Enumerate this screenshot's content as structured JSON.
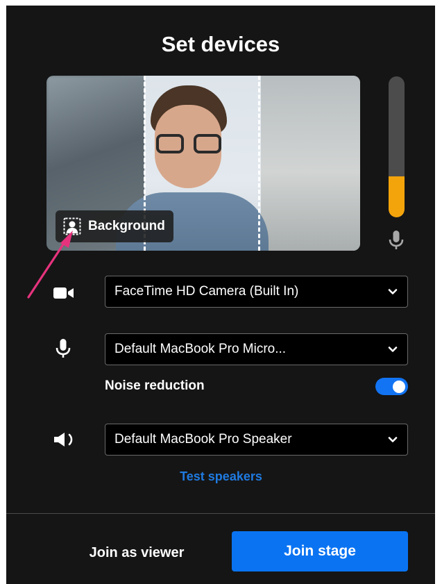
{
  "title": "Set devices",
  "preview": {
    "background_button_label": "Background",
    "background_icon": "background-person-icon"
  },
  "mic_level": 0.29,
  "camera": {
    "icon": "video-camera-icon",
    "selected": "FaceTime HD Camera (Built In)"
  },
  "microphone": {
    "icon": "microphone-icon",
    "selected": "Default MacBook Pro Micro...",
    "noise_reduction_label": "Noise reduction",
    "noise_reduction_on": true
  },
  "speaker": {
    "icon": "speaker-icon",
    "selected": "Default MacBook Pro Speaker",
    "test_label": "Test speakers"
  },
  "actions": {
    "join_viewer_label": "Join as viewer",
    "join_stage_label": "Join stage"
  },
  "colors": {
    "panel": "#151515",
    "accent_blue": "#0a73f2",
    "meter_level": "#f4a40b",
    "annotation_arrow": "#e6337d"
  }
}
